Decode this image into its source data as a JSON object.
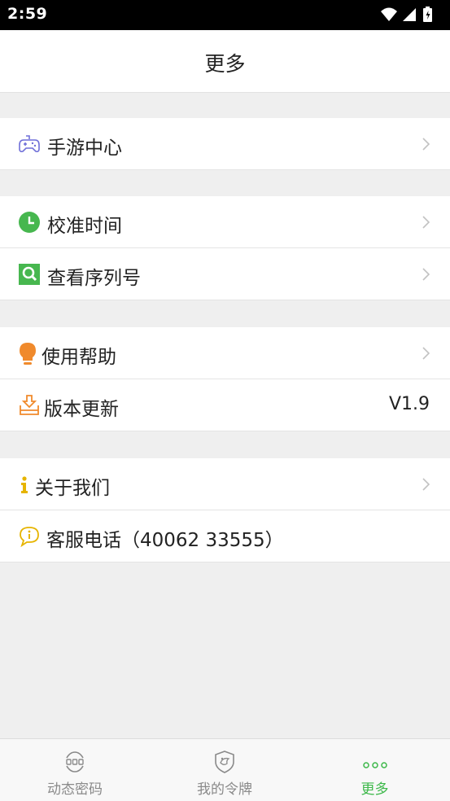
{
  "status": {
    "time": "2:59"
  },
  "header": {
    "title": "更多"
  },
  "groups": {
    "games": {
      "game_center": "手游中心"
    },
    "token": {
      "calibrate_time": "校准时间",
      "view_serial": "查看序列号"
    },
    "support": {
      "help": "使用帮助",
      "version_update": "版本更新",
      "version": "V1.9"
    },
    "about": {
      "about_us": "关于我们",
      "service_phone": "客服电话（40062 33555）"
    }
  },
  "tabs": [
    {
      "label": "动态密码",
      "icon": "dynamic-code-icon",
      "active": false
    },
    {
      "label": "我的令牌",
      "icon": "shield-icon",
      "active": false
    },
    {
      "label": "更多",
      "icon": "more-dots-icon",
      "active": true
    }
  ],
  "colors": {
    "accent_green": "#3db84a",
    "game_purple": "#6f6fd8",
    "clock_green": "#47b74f",
    "orange": "#f08a2c",
    "yellow": "#e6b400"
  }
}
